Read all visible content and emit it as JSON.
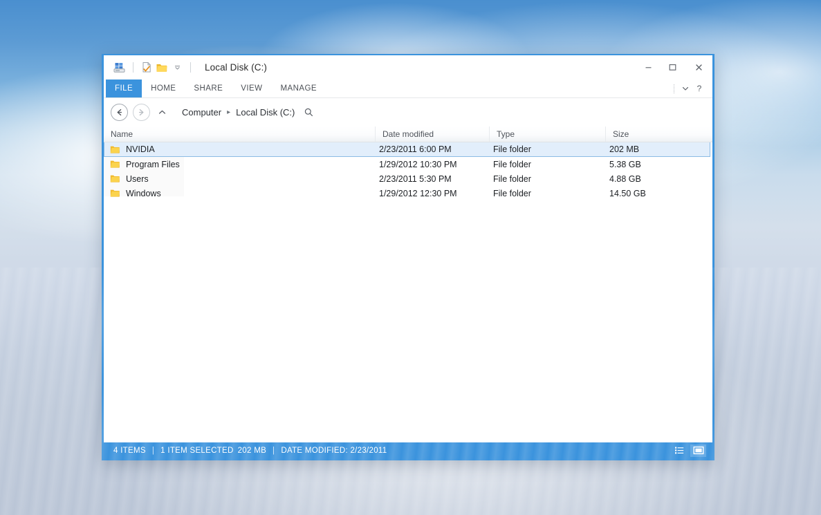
{
  "window": {
    "title": "Local Disk (C:)",
    "accent_color": "#3b93dd",
    "quick_access": [
      {
        "name": "drive-properties-icon",
        "label": "Properties"
      },
      {
        "name": "new-document-icon",
        "label": "New"
      },
      {
        "name": "new-folder-icon",
        "label": "New folder"
      },
      {
        "name": "chevron-down-icon",
        "label": "Customize Quick Access Toolbar"
      }
    ],
    "controls": {
      "minimize": "–",
      "maximize": "□",
      "close": "✕"
    }
  },
  "ribbon": {
    "tabs": [
      {
        "label": "FILE",
        "active": true
      },
      {
        "label": "HOME",
        "active": false
      },
      {
        "label": "SHARE",
        "active": false
      },
      {
        "label": "VIEW",
        "active": false
      },
      {
        "label": "MANAGE",
        "active": false
      }
    ],
    "expand_label": "⌄",
    "help_label": "?"
  },
  "navbar": {
    "back_label": "←",
    "forward_label": "→",
    "up_label": "⌃",
    "breadcrumbs": [
      {
        "label": "Computer"
      },
      {
        "label": "Local Disk (C:)"
      }
    ],
    "separator": "▸",
    "search_icon": "search-icon"
  },
  "columns": [
    {
      "key": "name",
      "label": "Name"
    },
    {
      "key": "date",
      "label": "Date modified"
    },
    {
      "key": "type",
      "label": "Type"
    },
    {
      "key": "size",
      "label": "Size"
    }
  ],
  "files": [
    {
      "name": "NVIDIA",
      "date": "2/23/2011 6:00 PM",
      "type": "File folder",
      "size": "202 MB",
      "selected": true
    },
    {
      "name": "Program Files",
      "date": "1/29/2012 10:30 PM",
      "type": "File folder",
      "size": "5.38 GB",
      "selected": false
    },
    {
      "name": "Users",
      "date": "2/23/2011 5:30 PM",
      "type": "File folder",
      "size": "4.88 GB",
      "selected": false
    },
    {
      "name": "Windows",
      "date": "1/29/2012 12:30 PM",
      "type": "File folder",
      "size": "14.50 GB",
      "selected": false
    }
  ],
  "statusbar": {
    "item_count": "4 ITEMS",
    "sep1": "|",
    "selection": "1 ITEM SELECTED",
    "selection_size": "202 MB",
    "sep2": "|",
    "date_modified": "DATE MODIFIED: 2/23/2011",
    "views": [
      {
        "name": "details-view-button",
        "active": false
      },
      {
        "name": "large-icons-view-button",
        "active": true
      }
    ]
  }
}
